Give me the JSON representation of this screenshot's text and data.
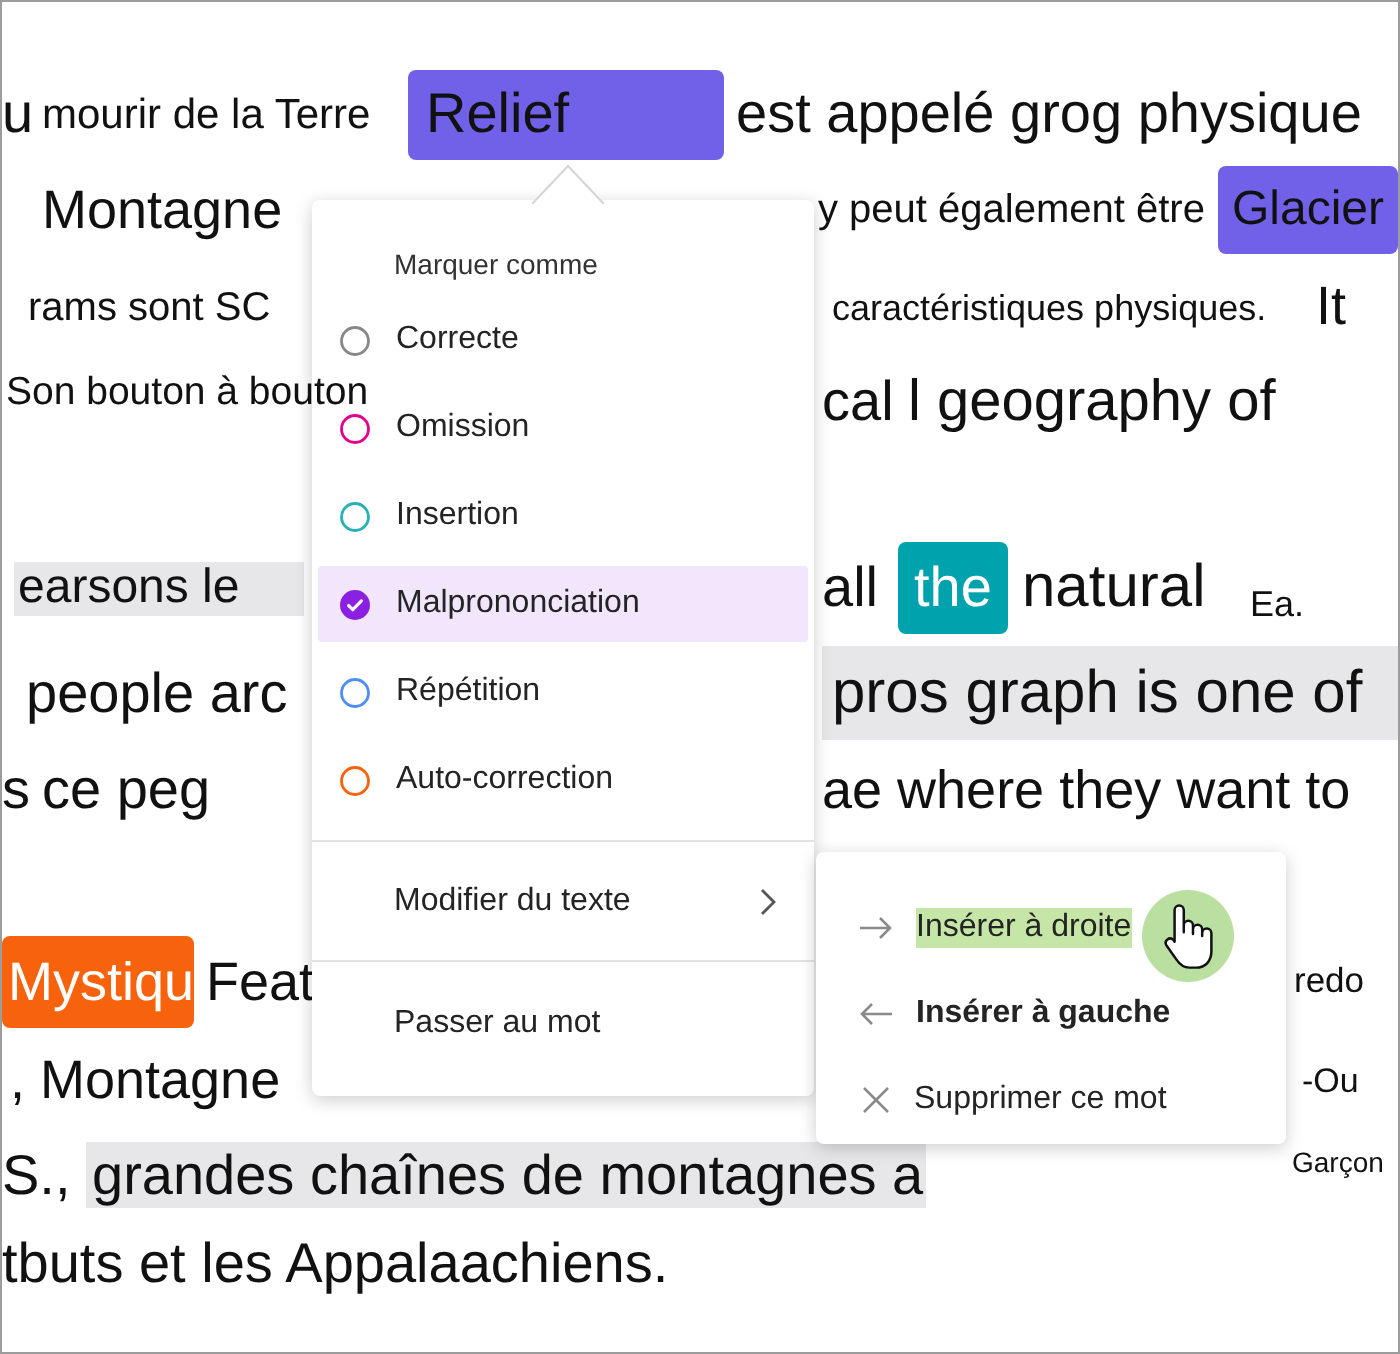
{
  "passage": {
    "lines": [
      {
        "fragments": [
          {
            "kind": "word",
            "text": "u"
          },
          {
            "kind": "label",
            "text": "mourir de la Terre"
          },
          {
            "kind": "tag",
            "text": "Relief",
            "color": "#7160e8",
            "light_text": false
          },
          {
            "kind": "word",
            "text": "est appelé grog physique"
          }
        ]
      },
      {
        "fragments": [
          {
            "kind": "word",
            "text": "Montagne"
          },
          {
            "kind": "label",
            "text": "y peut également être"
          },
          {
            "kind": "tag",
            "text": "Glacier",
            "color": "#7160e8",
            "light_text": false
          }
        ]
      },
      {
        "fragments": [
          {
            "kind": "label",
            "text": "rams sont SC"
          },
          {
            "kind": "label",
            "text": "caractéristiques physiques."
          },
          {
            "kind": "word",
            "text": "It"
          }
        ]
      },
      {
        "fragments": [
          {
            "kind": "label",
            "text": "Son bouton à bouton"
          },
          {
            "kind": "word",
            "text": "cal"
          },
          {
            "kind": "word",
            "text": "l geography of"
          }
        ]
      },
      {
        "fragments": [
          {
            "kind": "highlight",
            "text": "earsons le"
          },
          {
            "kind": "word",
            "text": "all"
          },
          {
            "kind": "tag",
            "text": "the",
            "color": "#00a3ad",
            "light_text": true
          },
          {
            "kind": "word",
            "text": "natural"
          },
          {
            "kind": "label",
            "text": "Ea."
          }
        ]
      },
      {
        "fragments": [
          {
            "kind": "word",
            "text": "people arc"
          },
          {
            "kind": "highlight",
            "text": "pros graph is one of"
          }
        ]
      },
      {
        "fragments": [
          {
            "kind": "word",
            "text": "s"
          },
          {
            "kind": "word",
            "text": "ce peg"
          },
          {
            "kind": "word",
            "text": "ae where they want to"
          }
        ]
      },
      {
        "fragments": [
          {
            "kind": "tag",
            "text": "Mystiqu",
            "color": "#f7630c",
            "light_text": true
          },
          {
            "kind": "word",
            "text": "Feat"
          },
          {
            "kind": "label",
            "text": "redo"
          }
        ]
      },
      {
        "fragments": [
          {
            "kind": "word",
            "text": ", Montagne"
          },
          {
            "kind": "label",
            "text": "-Ou"
          }
        ]
      },
      {
        "fragments": [
          {
            "kind": "word",
            "text": "S.,"
          },
          {
            "kind": "highlight",
            "text": "grandes chaînes de montagnes a"
          },
          {
            "kind": "label",
            "text": "Garçon"
          }
        ]
      },
      {
        "fragments": [
          {
            "kind": "word",
            "text": "tbuts et les Appalaachiens."
          }
        ]
      }
    ]
  },
  "mark_menu": {
    "title": "Marquer comme",
    "options": [
      {
        "label": "Correcte",
        "color": "#8a8886",
        "selected": false
      },
      {
        "label": "Omission",
        "color": "#e3008c",
        "selected": false
      },
      {
        "label": "Insertion",
        "color": "#27b1b8",
        "selected": false
      },
      {
        "label": "Malprononciation",
        "color": "#8b20e3",
        "selected": true
      },
      {
        "label": "Répétition",
        "color": "#4f8ef7",
        "selected": false
      },
      {
        "label": "Auto-correction",
        "color": "#f7630c",
        "selected": false
      }
    ],
    "actions": [
      {
        "label": "Modifier du texte",
        "has_submenu": true
      },
      {
        "label": "Passer au mot",
        "has_submenu": false
      }
    ]
  },
  "edit_submenu": {
    "items": [
      {
        "kind": "insert_right",
        "label": "Insérer à droite",
        "highlighted": true,
        "focused": false
      },
      {
        "kind": "insert_left",
        "label": "Insérer à gauche",
        "highlighted": false,
        "focused": true
      },
      {
        "kind": "delete",
        "label": "Supprimer ce mot",
        "highlighted": false,
        "focused": false
      }
    ]
  }
}
